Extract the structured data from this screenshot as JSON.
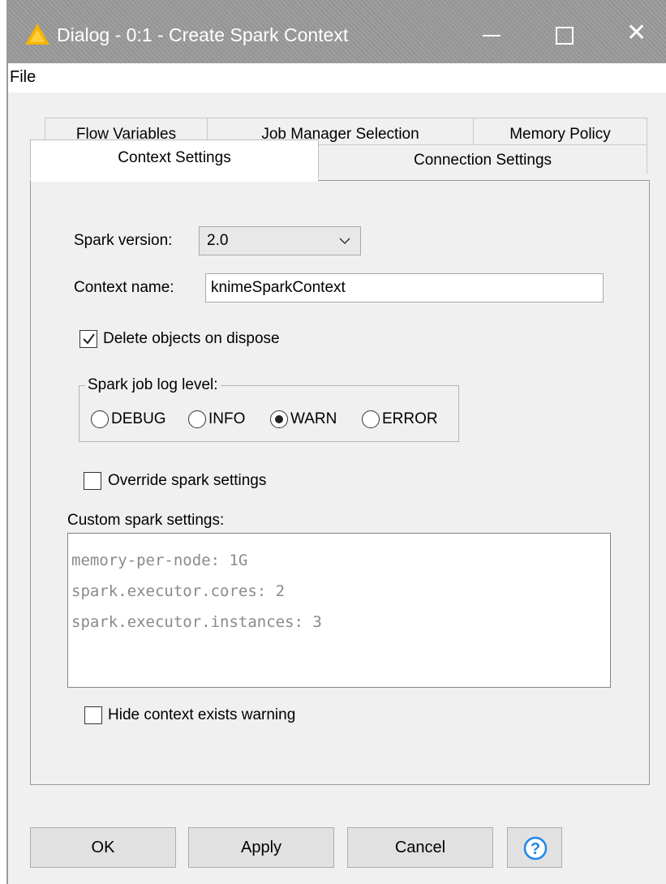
{
  "window": {
    "title": "Dialog - 0:1 - Create Spark Context"
  },
  "menu": {
    "file": "File"
  },
  "tabs": {
    "row1": [
      "Flow Variables",
      "Job Manager Selection",
      "Memory Policy"
    ],
    "row2": [
      "Context Settings",
      "Connection Settings"
    ],
    "active": "Context Settings"
  },
  "form": {
    "spark_version_label": "Spark version:",
    "spark_version_value": "2.0",
    "context_name_label": "Context name:",
    "context_name_value": "knimeSparkContext",
    "delete_objects_label": "Delete objects on dispose",
    "delete_objects_checked": true,
    "log_level_title": "Spark job log level:",
    "log_levels": [
      "DEBUG",
      "INFO",
      "WARN",
      "ERROR"
    ],
    "log_level_selected": "WARN",
    "override_label": "Override spark settings",
    "override_checked": false,
    "custom_settings_label": "Custom spark settings:",
    "custom_settings_lines": [
      "memory-per-node: 1G",
      "spark.executor.cores: 2",
      "spark.executor.instances: 3"
    ],
    "hide_warning_label": "Hide context exists warning",
    "hide_warning_checked": false
  },
  "buttons": {
    "ok": "OK",
    "apply": "Apply",
    "cancel": "Cancel"
  },
  "colors": {
    "titlebar": "#9b9b9b",
    "warning_icon": "#f5b400",
    "help_icon": "#1e88e5"
  },
  "icons": {
    "title": "warning-triangle-icon",
    "help": "question-mark-icon"
  }
}
